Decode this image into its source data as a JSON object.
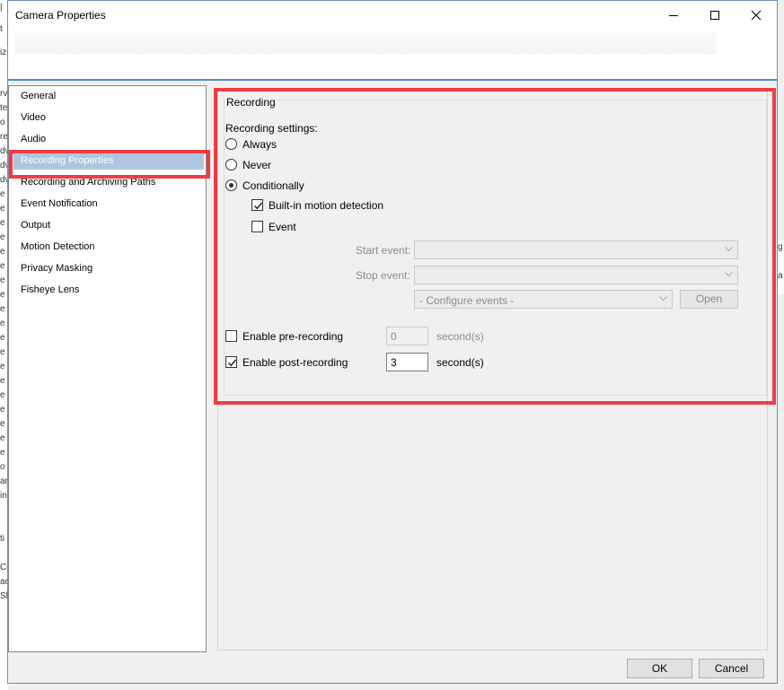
{
  "window": {
    "title": "Camera Properties"
  },
  "nav": {
    "items": [
      {
        "label": "General"
      },
      {
        "label": "Video"
      },
      {
        "label": "Audio"
      },
      {
        "label": "Recording Properties"
      },
      {
        "label": "Recording and Archiving Paths"
      },
      {
        "label": "Event Notification"
      },
      {
        "label": "Output"
      },
      {
        "label": "Motion Detection"
      },
      {
        "label": "Privacy Masking"
      },
      {
        "label": "Fisheye Lens"
      }
    ],
    "selected": "Recording Properties"
  },
  "recording": {
    "group_title": "Recording",
    "settings_label": "Recording settings:",
    "options": [
      {
        "label": "Always",
        "selected": false
      },
      {
        "label": "Never",
        "selected": false
      },
      {
        "label": "Conditionally",
        "selected": true
      }
    ],
    "motion_detection": {
      "label": "Built-in motion detection",
      "checked": true
    },
    "event": {
      "label": "Event",
      "checked": false
    },
    "start_event": {
      "label": "Start event:",
      "value": ""
    },
    "stop_event": {
      "label": "Stop event:",
      "value": ""
    },
    "configure_events": {
      "value": "- Configure events -"
    },
    "open_button": "Open",
    "pre_recording": {
      "label": "Enable pre-recording",
      "checked": false,
      "value": "0",
      "unit": "second(s)"
    },
    "post_recording": {
      "label": "Enable post-recording",
      "checked": true,
      "value": "3",
      "unit": "second(s)"
    }
  },
  "footer": {
    "ok": "OK",
    "cancel": "Cancel"
  },
  "colors": {
    "highlight": "#f03c44",
    "selection": "#aec6e0",
    "title_border": "#4f8ad0"
  }
}
